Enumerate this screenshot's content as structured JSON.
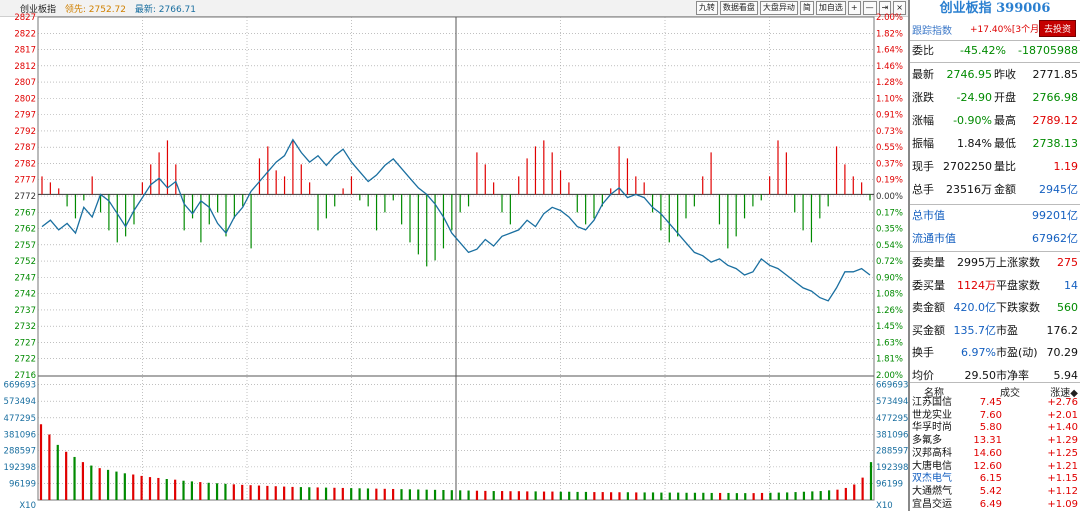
{
  "header": {
    "title": "创业板指",
    "lead_label": "领先: 2752.72",
    "last_label": "最新: 2766.71",
    "buttons": [
      "九转",
      "数据看盘",
      "大盘异动",
      "简",
      "加自选",
      "+",
      "—",
      "⇥",
      "×"
    ]
  },
  "colors": {
    "up": "#e00000",
    "down": "#008a00",
    "price_line": "#1a6fa0",
    "grid": "#9a9a9a",
    "axis_left": "#e00000",
    "axis_right": "#e00000"
  },
  "chart_data": {
    "type": "line",
    "price_axis": {
      "ticks": [
        "2827",
        "2822",
        "2817",
        "2812",
        "2807",
        "2802",
        "2797",
        "2792",
        "2787",
        "2782",
        "2777",
        "2772",
        "2767",
        "2762",
        "2757",
        "2752",
        "2747",
        "2742",
        "2737",
        "2732",
        "2727",
        "2722",
        "2716"
      ],
      "pct_ticks": [
        "2.00%",
        "1.82%",
        "1.64%",
        "1.46%",
        "1.28%",
        "1.10%",
        "0.91%",
        "0.73%",
        "0.55%",
        "0.37%",
        "0.19%",
        "0.00%",
        "0.17%",
        "0.35%",
        "0.54%",
        "0.72%",
        "0.90%",
        "1.08%",
        "1.26%",
        "1.45%",
        "1.63%",
        "1.81%",
        "2.00%"
      ],
      "ylim": [
        2716,
        2827
      ],
      "prev_close": 2772
    },
    "volume_axis": {
      "ticks": [
        "669693",
        "573494",
        "477295",
        "381096",
        "288597",
        "192398",
        "96199"
      ],
      "corner": "X10",
      "ylim": [
        0,
        720000
      ]
    },
    "price_line": [
      2762,
      2764,
      2761,
      2763,
      2760,
      2768,
      2765,
      2772,
      2770,
      2766,
      2762,
      2767,
      2771,
      2775,
      2777,
      2774,
      2776,
      2769,
      2766,
      2770,
      2768,
      2763,
      2760,
      2765,
      2768,
      2773,
      2776,
      2779,
      2782,
      2784,
      2789,
      2785,
      2782,
      2784,
      2781,
      2784,
      2786,
      2782,
      2779,
      2776,
      2778,
      2781,
      2783,
      2780,
      2777,
      2774,
      2772,
      2769,
      2765,
      2760,
      2757,
      2754,
      2755,
      2758,
      2756,
      2759,
      2760,
      2761,
      2764,
      2762,
      2766,
      2768,
      2767,
      2765,
      2762,
      2761,
      2764,
      2769,
      2772,
      2774,
      2771,
      2772,
      2771,
      2768,
      2766,
      2763,
      2760,
      2757,
      2754,
      2753,
      2751,
      2752,
      2750,
      2749,
      2747,
      2748,
      2752,
      2750,
      2749,
      2747,
      2745,
      2743,
      2742,
      2740,
      2739,
      2743,
      2748,
      2748,
      2749,
      2747
    ],
    "bars": [
      3,
      2,
      1,
      -2,
      -4,
      -1,
      3,
      -3,
      -6,
      -8,
      -7,
      -5,
      2,
      5,
      7,
      9,
      5,
      -6,
      -4,
      -8,
      -5,
      -3,
      -7,
      -4,
      -2,
      -9,
      6,
      8,
      4,
      3,
      9,
      5,
      2,
      -6,
      -4,
      -2,
      1,
      3,
      -1,
      -2,
      -6,
      -3,
      -1,
      -5,
      -8,
      -10,
      -12,
      -11,
      -9,
      -6,
      -3,
      -2,
      7,
      5,
      2,
      -3,
      -5,
      3,
      6,
      8,
      9,
      7,
      4,
      2,
      -3,
      -5,
      -4,
      -2,
      1,
      8,
      6,
      3,
      2,
      -3,
      -6,
      -8,
      -7,
      -4,
      -2,
      3,
      7,
      -5,
      -9,
      -7,
      -4,
      -2,
      -1,
      3,
      9,
      7,
      -3,
      -6,
      -8,
      -4,
      -2,
      8,
      5,
      3,
      2,
      -1
    ],
    "volume": [
      440000,
      380000,
      320000,
      280000,
      250000,
      220000,
      200000,
      185000,
      175000,
      165000,
      155000,
      148000,
      140000,
      133000,
      128000,
      122000,
      118000,
      112000,
      108000,
      104000,
      100000,
      97000,
      94000,
      91000,
      88000,
      86000,
      84000,
      82000,
      80000,
      78000,
      76000,
      75000,
      74000,
      73000,
      72000,
      71000,
      70000,
      69000,
      68000,
      67000,
      66000,
      65000,
      64000,
      63000,
      62000,
      61000,
      60000,
      59000,
      58000,
      57000,
      56000,
      55000,
      54000,
      53000,
      52000,
      52000,
      51000,
      51000,
      50000,
      50000,
      49000,
      49000,
      48000,
      48000,
      47000,
      47000,
      46000,
      46000,
      45000,
      45000,
      45000,
      44000,
      44000,
      44000,
      43000,
      43000,
      43000,
      42000,
      42000,
      42000,
      41000,
      41000,
      41000,
      40000,
      40000,
      40000,
      41000,
      42000,
      43000,
      44000,
      46000,
      48000,
      50000,
      52000,
      56000,
      60000,
      70000,
      90000,
      130000,
      220000
    ]
  },
  "panel": {
    "title": "创业板指 399006",
    "track_label": "跟踪指数",
    "track_value": "+17.40%[3个月]",
    "track_button": "去投资",
    "weibi_label": "委比",
    "weibi_pct": "-45.42%",
    "weibi_diff": "-18705988",
    "rows": [
      {
        "l1": "最新",
        "v1": "2746.95",
        "c1": "green",
        "l2": "昨收",
        "v2": "2771.85",
        "c2": "blk"
      },
      {
        "l1": "涨跌",
        "v1": "-24.90",
        "c1": "green",
        "l2": "开盘",
        "v2": "2766.98",
        "c2": "green"
      },
      {
        "l1": "涨幅",
        "v1": "-0.90%",
        "c1": "green",
        "l2": "最高",
        "v2": "2789.12",
        "c2": "red"
      },
      {
        "l1": "振幅",
        "v1": "1.84%",
        "c1": "blk",
        "l2": "最低",
        "v2": "2738.13",
        "c2": "green"
      },
      {
        "l1": "现手",
        "v1": "2702250",
        "c1": "blk",
        "l2": "量比",
        "v2": "1.19",
        "c2": "red"
      },
      {
        "l1": "总手",
        "v1": "23516万",
        "c1": "blk",
        "l2": "金额",
        "v2": "2945亿",
        "c2": "blue"
      }
    ],
    "total_mv_label": "总市值",
    "total_mv": "99201亿",
    "float_mv_label": "流通市值",
    "float_mv": "67962亿",
    "stats": [
      {
        "l1": "委卖量",
        "v1": "2995万",
        "c1": "blk",
        "l2": "上涨家数",
        "v2": "275",
        "c2": "red"
      },
      {
        "l1": "委买量",
        "v1": "1124万",
        "c1": "red",
        "l2": "平盘家数",
        "v2": "14",
        "c2": "blue"
      },
      {
        "l1": "卖金额",
        "v1": "420.0亿",
        "c1": "blue",
        "l2": "下跌家数",
        "v2": "560",
        "c2": "green"
      },
      {
        "l1": "买金额",
        "v1": "135.7亿",
        "c1": "blue",
        "l2": "市盈",
        "v2": "176.2",
        "c2": "blk"
      },
      {
        "l1": "换手",
        "v1": "6.97%",
        "c1": "blue",
        "l2": "市盈(动)",
        "v2": "70.29",
        "c2": "blk"
      },
      {
        "l1": "均价",
        "v1": "29.50",
        "c1": "blk",
        "l2": "市净率",
        "v2": "5.94",
        "c2": "blk"
      }
    ],
    "stock_header": {
      "name": "名称",
      "price": "成交",
      "change": "涨速◆"
    },
    "stocks": [
      {
        "name": "江苏国信",
        "price": "7.45",
        "change": "+2.76",
        "name_color": "blk"
      },
      {
        "name": "世龙实业",
        "price": "7.60",
        "change": "+2.01",
        "name_color": "blk"
      },
      {
        "name": "华孚时尚",
        "price": "5.80",
        "change": "+1.40",
        "name_color": "blk"
      },
      {
        "name": "多氟多",
        "price": "13.31",
        "change": "+1.29",
        "name_color": "blk"
      },
      {
        "name": "汉邦高科",
        "price": "14.60",
        "change": "+1.25",
        "name_color": "blk"
      },
      {
        "name": "大唐电信",
        "price": "12.60",
        "change": "+1.21",
        "name_color": "blk"
      },
      {
        "name": "双杰电气",
        "price": "6.15",
        "change": "+1.15",
        "name_color": "blue"
      },
      {
        "name": "大通燃气",
        "price": "5.42",
        "change": "+1.12",
        "name_color": "blk"
      },
      {
        "name": "宜昌交运",
        "price": "6.49",
        "change": "+1.09",
        "name_color": "blk"
      }
    ]
  }
}
